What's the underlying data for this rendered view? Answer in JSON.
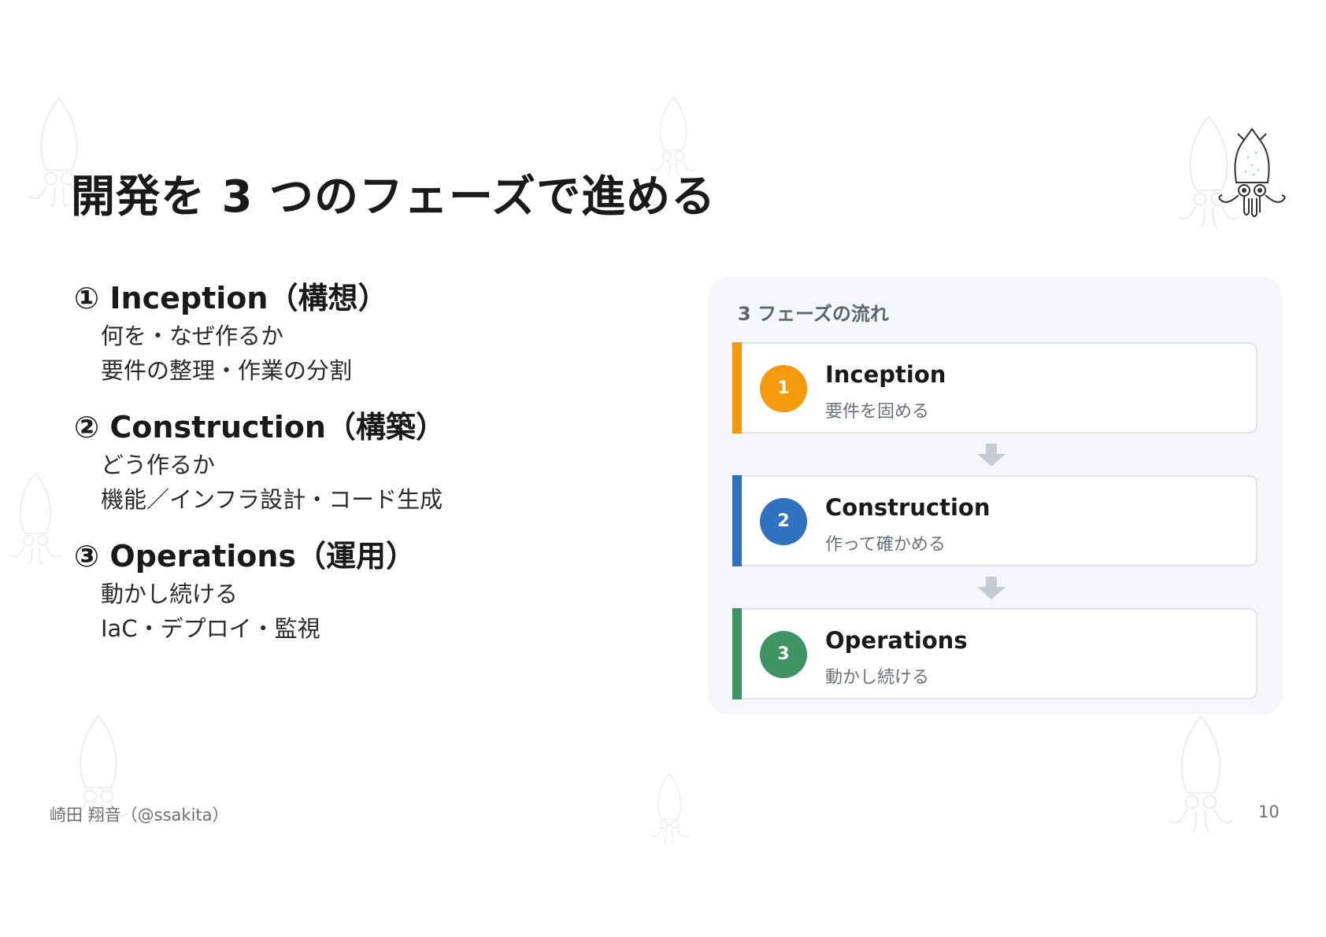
{
  "slide": {
    "title": "開発を 3 つのフェーズで進める",
    "phases": [
      {
        "heading": "① Inception（構想）",
        "lines": [
          "何を・なぜ作るか",
          "要件の整理・作業の分割"
        ]
      },
      {
        "heading": "② Construction（構築）",
        "lines": [
          "どう作るか",
          "機能／インフラ設計・コード生成"
        ]
      },
      {
        "heading": "③ Operations（運用）",
        "lines": [
          "動かし続ける",
          "IaC・デプロイ・監視"
        ]
      }
    ],
    "panel": {
      "title": "3 フェーズの流れ",
      "cards": [
        {
          "number": "1",
          "name": "Inception",
          "description": "要件を固める",
          "color": "#f59a0c"
        },
        {
          "number": "2",
          "name": "Construction",
          "description": "作って確かめる",
          "color": "#2f72c0"
        },
        {
          "number": "3",
          "name": "Operations",
          "description": "動かし続ける",
          "color": "#3f9464"
        }
      ],
      "arrow_color": "#c5cbd3"
    },
    "footer": {
      "author": "崎田 翔音（@ssakita）",
      "page_number": "10"
    },
    "icons": {
      "logo": "squid-logo-icon",
      "background": "squid-watermark-icon"
    }
  }
}
